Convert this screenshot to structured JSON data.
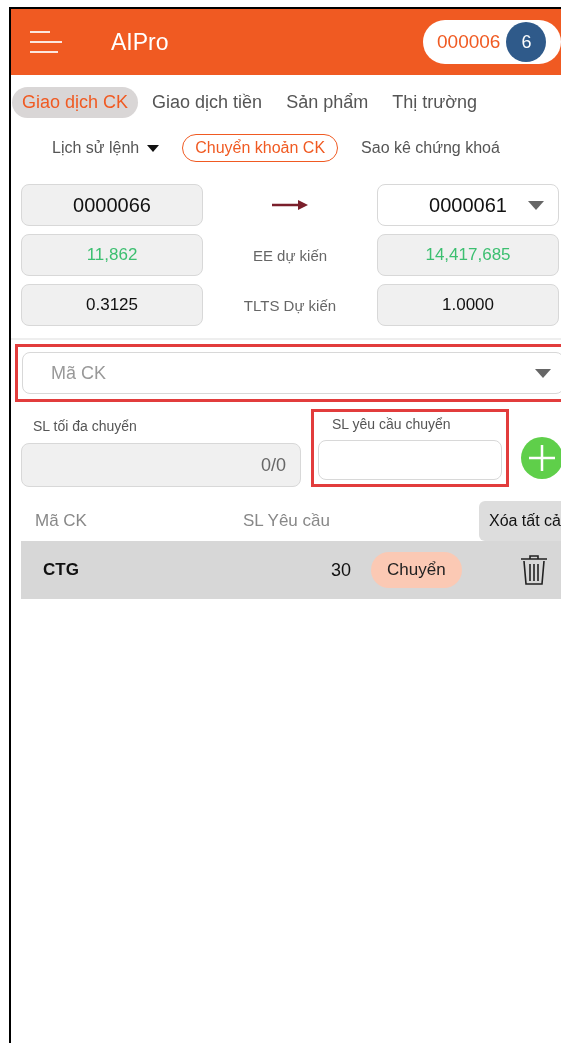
{
  "header": {
    "title": "AIPro",
    "account": "000006",
    "badge": "6"
  },
  "tabs": [
    {
      "label": "Giao dịch CK",
      "selected": true
    },
    {
      "label": "Giao dịch tiền",
      "selected": false
    },
    {
      "label": "Sản phẩm",
      "selected": false
    },
    {
      "label": "Thị trường",
      "selected": false
    }
  ],
  "subtabs": [
    {
      "label": "Lịch sử lệnh",
      "kind": "dropdown",
      "selected": false
    },
    {
      "label": "Chuyển khoản CK",
      "kind": "plain",
      "selected": true
    },
    {
      "label": "Sao kê chứng khoá",
      "kind": "plain",
      "selected": false
    }
  ],
  "transfer": {
    "from_account": "0000066",
    "to_account": "0000061",
    "rows": [
      {
        "label": "EE dự kiến",
        "from": "11,862",
        "to": "14,417,685",
        "kind": "money"
      },
      {
        "label": "TLTS Dự kiến",
        "from": "0.3125",
        "to": "1.0000",
        "kind": "ratio"
      }
    ]
  },
  "symbol_select": {
    "placeholder": "Mã CK",
    "highlighted": true
  },
  "max_qty": {
    "label": "SL tối đa chuyển",
    "value": "0/0"
  },
  "request_qty": {
    "label": "SL yêu cầu chuyển",
    "highlighted": true
  },
  "table": {
    "columns": [
      "Mã CK",
      "SL Yêu cầu"
    ],
    "clear_button": "Xóa tất cả",
    "rows": [
      {
        "symbol": "CTG",
        "qty": "30",
        "action": "Chuyển"
      }
    ]
  }
}
